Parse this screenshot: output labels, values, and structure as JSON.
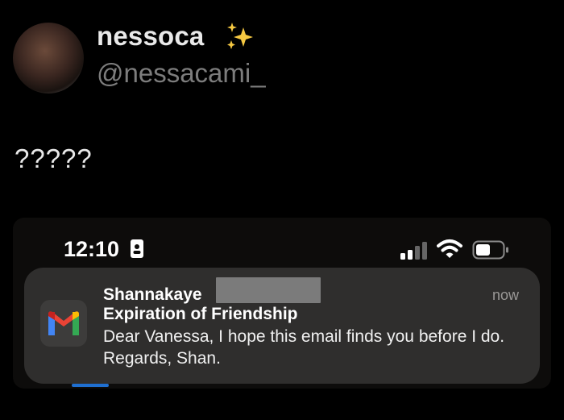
{
  "tweet": {
    "display_name": "nessoca",
    "handle": "@nessacami_",
    "text": "?????"
  },
  "icons": {
    "avatar": "profile-photo",
    "sparkles": "sparkles-emoji"
  },
  "phone_screenshot": {
    "status_bar": {
      "time": "12:10",
      "icons": [
        "id-badge-icon",
        "cellular-signal-icon",
        "wifi-icon",
        "battery-icon"
      ]
    },
    "notification": {
      "app_icon": "gmail-icon",
      "sender": "Shannakaye",
      "time": "now",
      "subject": "Expiration of Friendship",
      "body": "Dear Vanessa, I hope this email finds you before I do. Regards, Shan."
    }
  },
  "colors": {
    "background": "#000000",
    "handle_gray": "#7d7d7d",
    "notification_bg": "#2f2e2d",
    "redaction_gray": "#7b7b7b"
  }
}
